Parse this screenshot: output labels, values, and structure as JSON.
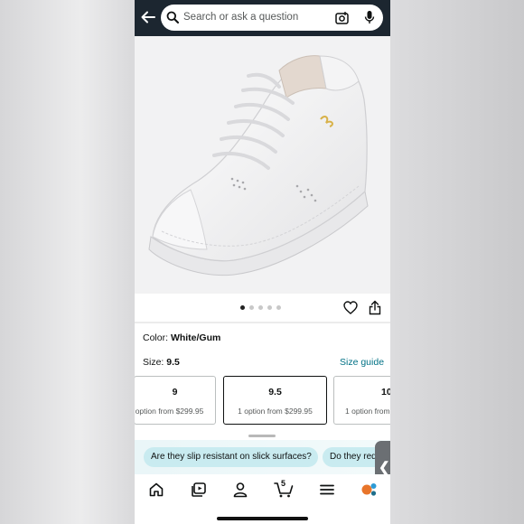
{
  "search": {
    "placeholder": "Search or ask a question"
  },
  "header": {
    "back_icon": "arrow-left-icon",
    "search_icon": "magnifier-icon",
    "camera_icon": "camera-lens-icon",
    "mic_icon": "microphone-icon"
  },
  "gallery": {
    "image_count": 5,
    "active_index": 0
  },
  "product": {
    "color_label": "Color:",
    "color_value": "White/Gum",
    "size_label": "Size:",
    "size_value": "9.5",
    "size_guide": "Size guide"
  },
  "sizes": [
    {
      "size": "9",
      "option": "option from $299.95"
    },
    {
      "size": "9.5",
      "option": "1 option from $299.95"
    },
    {
      "size": "10",
      "option": "1 option from"
    }
  ],
  "questions": [
    "Are they slip resistant on slick surfaces?",
    "Do they req"
  ],
  "nav": {
    "cart_count": "5"
  },
  "colors": {
    "header_bg": "#1c2630",
    "link": "#007185",
    "chip_bg": "#c9ebf0"
  }
}
